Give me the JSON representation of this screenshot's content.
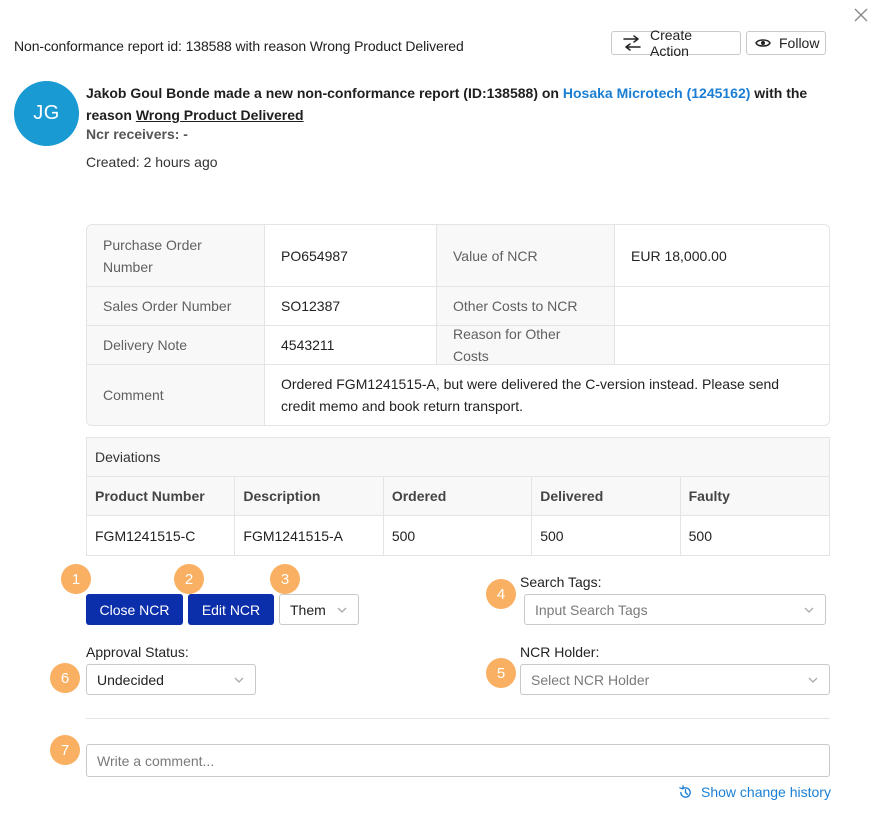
{
  "header": {
    "title": "Non-conformance report id: 138588 with reason Wrong Product Delivered",
    "create_action_label": "Create Action",
    "follow_label": "Follow"
  },
  "author": {
    "initials": "JG",
    "avatar_color": "#1a9ad3"
  },
  "intro": {
    "prefix": "Jakob Goul Bonde made a new non-conformance report (ID:138588) on ",
    "company": "Hosaka Microtech (1245162)",
    "middle": " with the reason ",
    "reason": "Wrong Product Delivered",
    "receivers": "Ncr receivers: -",
    "created": "Created: 2 hours ago"
  },
  "info": {
    "po_label": "Purchase Order Number",
    "po_value": "PO654987",
    "value_label": "Value of NCR",
    "value_value": "EUR 18,000.00",
    "so_label": "Sales Order Number",
    "so_value": "SO12387",
    "other_costs_label": "Other Costs to NCR",
    "other_costs_value": "",
    "delivery_label": "Delivery Note",
    "delivery_value": "4543211",
    "reason_other_label": "Reason for Other Costs",
    "reason_other_value": "",
    "comment_label": "Comment",
    "comment_value": "Ordered FGM1241515-A, but were delivered the C-version instead. Please send credit memo and book return transport."
  },
  "deviations": {
    "caption": "Deviations",
    "columns": [
      "Product Number",
      "Description",
      "Ordered",
      "Delivered",
      "Faulty"
    ],
    "rows": [
      [
        "FGM1241515-C",
        "FGM1241515-A",
        "500",
        "500",
        "500"
      ]
    ]
  },
  "badges": [
    "1",
    "2",
    "3",
    "4",
    "5",
    "6",
    "7"
  ],
  "actions": {
    "close_ncr": "Close NCR",
    "edit_ncr": "Edit NCR",
    "theme_value": "Them"
  },
  "search_tags": {
    "label": "Search Tags:",
    "placeholder": "Input Search Tags"
  },
  "approval": {
    "label": "Approval Status:",
    "value": "Undecided"
  },
  "holder": {
    "label": "NCR Holder:",
    "placeholder": "Select NCR Holder"
  },
  "comment": {
    "placeholder": "Write a comment..."
  },
  "history_label": "Show change history",
  "colors": {
    "primary_button": "#0b2eaa",
    "link": "#1a7fd4",
    "badge": "#f9b062"
  }
}
